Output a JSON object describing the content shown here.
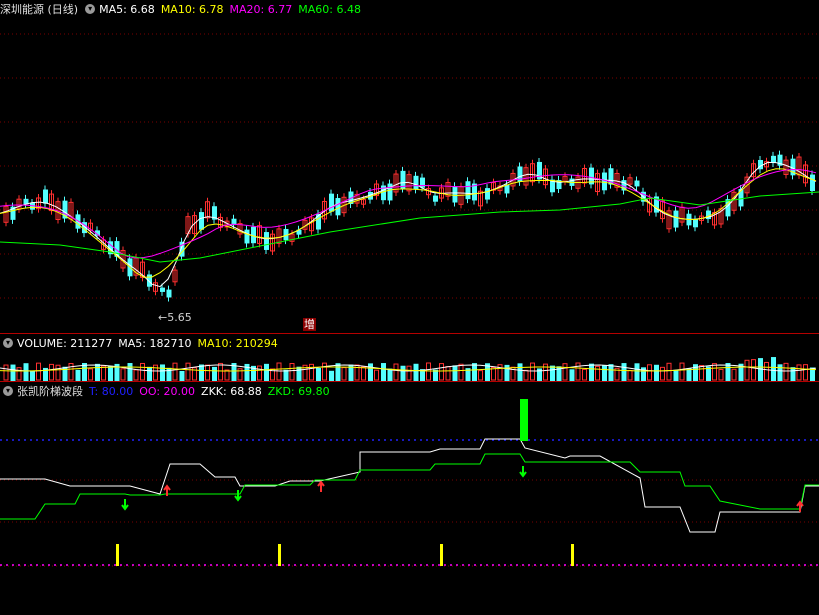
{
  "price_header": {
    "title": "深圳能源 (日线)",
    "ma5": "MA5: 6.68",
    "ma10": "MA10: 6.78",
    "ma20": "MA20: 6.77",
    "ma60": "MA60: 6.48"
  },
  "price_annotations": {
    "low_label": "5.65",
    "marker": "增"
  },
  "volume_header": {
    "volume": "VOLUME: 211277",
    "ma5": "MA5: 182710",
    "ma10": "MA10: 210294"
  },
  "indicator_header": {
    "title": "张凯阶梯波段",
    "t": "T: 80.00",
    "oo": "OO: 20.00",
    "zkk": "ZKK: 68.88",
    "zkd": "ZKD: 69.80"
  },
  "colors": {
    "up": "#ff3030",
    "down": "#54ffff",
    "ma5": "#ffffff",
    "ma10": "#ffff00",
    "ma20": "#ff00ff",
    "ma60": "#00ff00",
    "zkk": "#ffffff",
    "zkd": "#00ff00",
    "t_line": "#2020ff",
    "oo_line": "#ff00ff"
  },
  "icons": {
    "collapse": "chevron-down-icon"
  }
}
